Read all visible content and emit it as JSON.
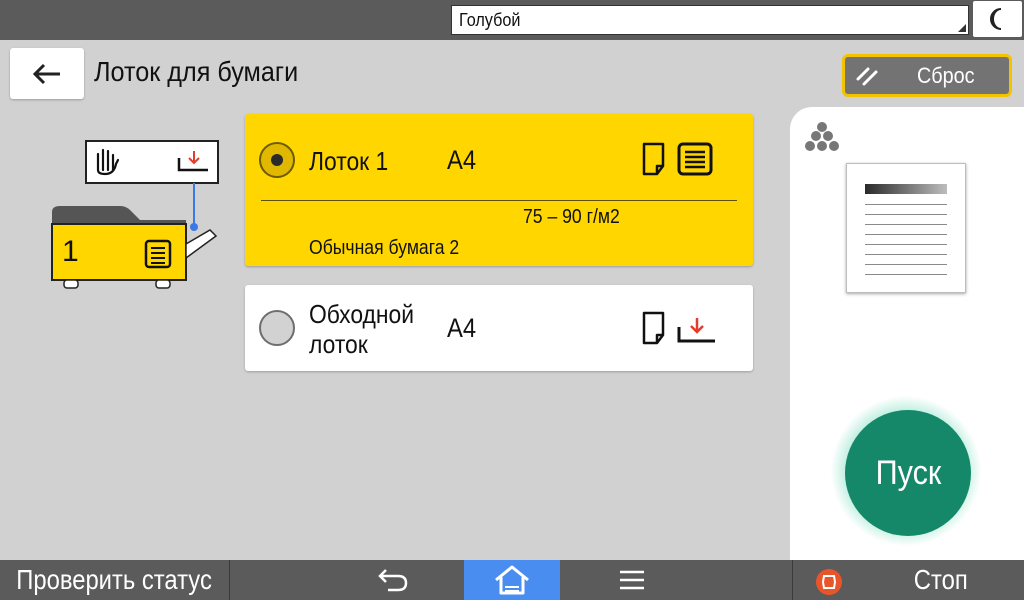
{
  "topbar": {
    "theme_select_value": "Голубой",
    "night_mode_icon": "moon-icon"
  },
  "header": {
    "back_icon": "arrow-left-icon",
    "title": "Лоток для бумаги",
    "reset_label": "Сброс",
    "reset_icon": "reset-slash-icon"
  },
  "tray_illustration": {
    "tray_number": "1"
  },
  "options": {
    "tray1": {
      "selected": true,
      "name": "Лоток 1",
      "size": "A4",
      "weight": "75 – 90 г/м2",
      "paper_type": "Обычная бумага 2",
      "icons": [
        "portrait-paper-icon",
        "paper-stack-icon"
      ]
    },
    "bypass": {
      "selected": false,
      "name_line1": "Обходной",
      "name_line2": "лоток",
      "size": "A4",
      "icons": [
        "portrait-paper-icon",
        "bypass-tray-icon"
      ]
    }
  },
  "right_panel": {
    "colour_mode_icon": "colour-dots-icon",
    "start_label": "Пуск"
  },
  "bottombar": {
    "status_label": "Проверить статус",
    "stop_label": "Стоп",
    "undo_icon": "undo-icon",
    "home_icon": "home-icon",
    "menu_icon": "menu-icon",
    "stop_icon": "stop-icon"
  },
  "colors": {
    "bars": "#5b5b5b",
    "selected_card": "#ffd600",
    "reset_border": "#f3c300",
    "start_button": "#15886a",
    "home_button": "#4a8df0",
    "alert_red": "#e53b2b"
  }
}
